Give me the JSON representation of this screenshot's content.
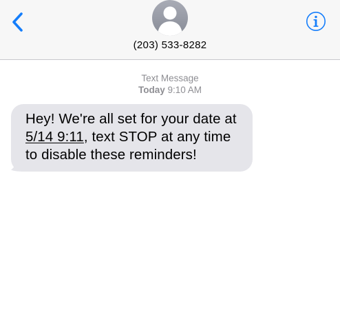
{
  "header": {
    "contact_name": "(203) 533-8282",
    "back_icon": "chevron-left-icon",
    "info_icon": "info-circle-icon",
    "avatar_icon": "person-silhouette-icon",
    "accent_color": "#157efb"
  },
  "conversation": {
    "service_label": "Text Message",
    "day_label": "Today",
    "time_label": "9:10 AM",
    "messages": [
      {
        "direction": "incoming",
        "text_before_link": "Hey! We're all set for your date at ",
        "link_text": "5/14 9:11",
        "text_after_link": ", text STOP at any time to disable these reminders!",
        "bubble_color": "#e5e5ea"
      }
    ]
  }
}
